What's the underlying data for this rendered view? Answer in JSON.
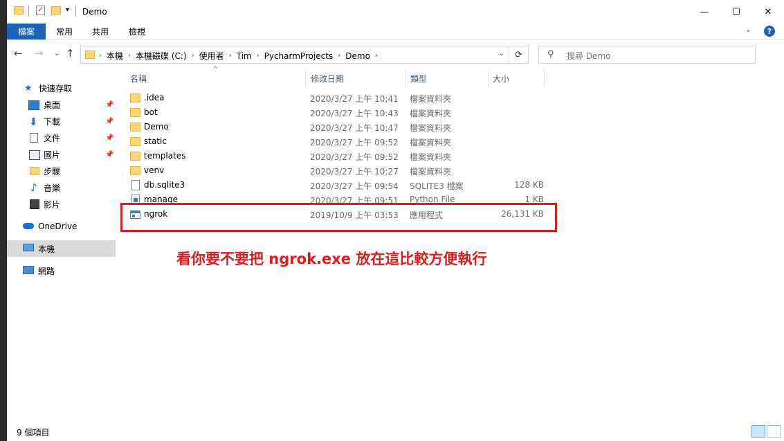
{
  "window": {
    "title": "Demo",
    "controls": {
      "minimize": "—",
      "maximize": "☐",
      "close": "✕"
    }
  },
  "ribbon": {
    "tabs": [
      "檔案",
      "常用",
      "共用",
      "檢視"
    ]
  },
  "address": {
    "crumbs": [
      "本機",
      "本機磁碟 (C:)",
      "使用者",
      "Tim",
      "PycharmProjects",
      "Demo"
    ],
    "search_placeholder": "搜尋 Demo"
  },
  "nav": {
    "items": [
      {
        "label": "快速存取",
        "icon": "star-icon"
      },
      {
        "label": "桌面",
        "icon": "desktop-icon",
        "pinned": true
      },
      {
        "label": "下載",
        "icon": "download-icon",
        "pinned": true
      },
      {
        "label": "文件",
        "icon": "documents-icon",
        "pinned": true
      },
      {
        "label": "圖片",
        "icon": "pictures-icon",
        "pinned": true
      },
      {
        "label": "步驟",
        "icon": "folder-icon"
      },
      {
        "label": "音樂",
        "icon": "music-icon"
      },
      {
        "label": "影片",
        "icon": "video-icon"
      },
      {
        "label": "OneDrive",
        "icon": "onedrive-icon"
      },
      {
        "label": "本機",
        "icon": "computer-icon",
        "selected": true
      },
      {
        "label": "網路",
        "icon": "network-icon"
      }
    ]
  },
  "columns": {
    "name": "名稱",
    "date": "修改日期",
    "type": "類型",
    "size": "大小"
  },
  "files": [
    {
      "name": ".idea",
      "date": "2020/3/27 上午 10:41",
      "type": "檔案資料夾",
      "size": "",
      "icon": "folder-icon"
    },
    {
      "name": "bot",
      "date": "2020/3/27 上午 10:43",
      "type": "檔案資料夾",
      "size": "",
      "icon": "folder-icon"
    },
    {
      "name": "Demo",
      "date": "2020/3/27 上午 10:47",
      "type": "檔案資料夾",
      "size": "",
      "icon": "folder-icon"
    },
    {
      "name": "static",
      "date": "2020/3/27 上午 09:52",
      "type": "檔案資料夾",
      "size": "",
      "icon": "folder-icon"
    },
    {
      "name": "templates",
      "date": "2020/3/27 上午 09:52",
      "type": "檔案資料夾",
      "size": "",
      "icon": "folder-icon"
    },
    {
      "name": "venv",
      "date": "2020/3/27 上午 10:27",
      "type": "檔案資料夾",
      "size": "",
      "icon": "folder-icon"
    },
    {
      "name": "db.sqlite3",
      "date": "2020/3/27 上午 09:54",
      "type": "SQLITE3 檔案",
      "size": "128 KB",
      "icon": "file-icon"
    },
    {
      "name": "manage",
      "date": "2020/3/27 上午 09:51",
      "type": "Python File",
      "size": "1 KB",
      "icon": "python-file-icon"
    },
    {
      "name": "ngrok",
      "date": "2019/10/9 上午 03:53",
      "type": "應用程式",
      "size": "26,131 KB",
      "icon": "application-icon"
    }
  ],
  "annotation": "看你要不要把 ngrok.exe 放在這比較方便執行",
  "status": {
    "count": "9 個項目"
  },
  "colors": {
    "accent": "#1a63b8",
    "annotation": "#e01b1b",
    "folder": "#f8d775"
  }
}
